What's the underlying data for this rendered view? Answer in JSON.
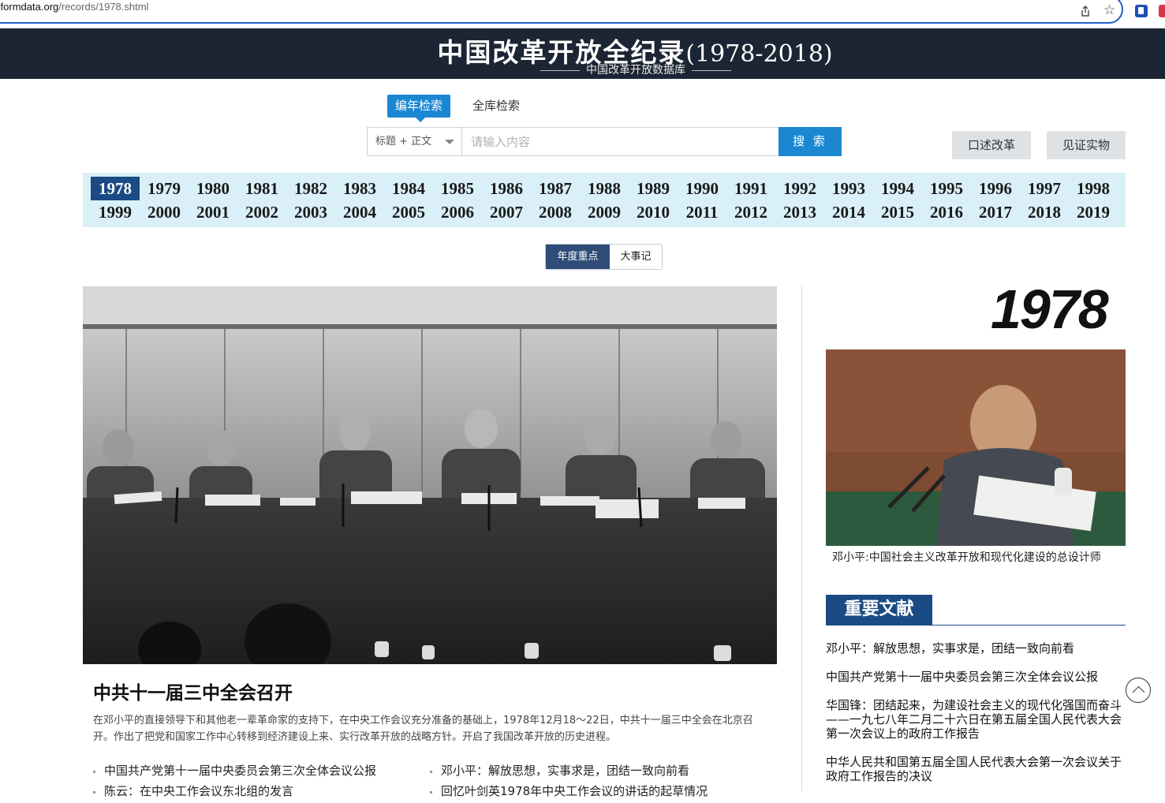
{
  "browser": {
    "url_domain": "reformdata.org",
    "url_path": "/records/1978.shtml"
  },
  "header": {
    "title": "中国改革开放全纪录",
    "title_years": "(1978-2018)",
    "subtitle": "中国改革开放数据库"
  },
  "search": {
    "tab_chrono": "编年检索",
    "tab_all": "全库检索",
    "scope_value": "标题 + 正文",
    "placeholder": "请输入内容",
    "button": "搜 索"
  },
  "side_buttons": {
    "oral": "口述改革",
    "witness": "见证实物"
  },
  "years": [
    "1978",
    "1979",
    "1980",
    "1981",
    "1982",
    "1983",
    "1984",
    "1985",
    "1986",
    "1987",
    "1988",
    "1989",
    "1990",
    "1991",
    "1992",
    "1993",
    "1994",
    "1995",
    "1996",
    "1997",
    "1998",
    "1999",
    "2000",
    "2001",
    "2002",
    "2003",
    "2004",
    "2005",
    "2006",
    "2007",
    "2008",
    "2009",
    "2010",
    "2011",
    "2012",
    "2013",
    "2014",
    "2015",
    "2016",
    "2017",
    "2018",
    "2019"
  ],
  "active_year": "1978",
  "toggle": {
    "highlights": "年度重点",
    "chronicle": "大事记"
  },
  "main": {
    "title": "中共十一届三中全会召开",
    "desc": "在邓小平的直接领导下和其他老一辈革命家的支持下，在中央工作会议充分准备的基础上，1978年12月18～22日，中共十一届三中全会在北京召开。作出了把党和国家工作中心转移到经济建设上来、实行改革开放的战略方针。开启了我国改革开放的历史进程。",
    "list_left": [
      "中国共产党第十一届中央委员会第三次全体会议公报",
      "陈云：在中央工作会议东北组的发言"
    ],
    "list_right": [
      "邓小平：解放思想，实事求是，团结一致向前看",
      "回忆叶剑英1978年中央工作会议的讲话的起草情况"
    ]
  },
  "side": {
    "year": "1978",
    "caption": "邓小平:中国社会主义改革开放和现代化建设的总设计师",
    "docs_heading": "重要文献",
    "docs": [
      "邓小平：解放思想，实事求是，团结一致向前看",
      "中国共产党第十一届中央委员会第三次全体会议公报",
      "华国锋：团结起来，为建设社会主义的现代化强国而奋斗——一九七八年二月二十六日在第五届全国人民代表大会第一次会议上的政府工作报告",
      "中华人民共和国第五届全国人民代表大会第一次会议关于政府工作报告的决议"
    ]
  },
  "colors": {
    "banner": "#1c2533",
    "accent_blue": "#1b87d3",
    "navy": "#1b4b84",
    "year_bg": "#d9f0f8"
  }
}
